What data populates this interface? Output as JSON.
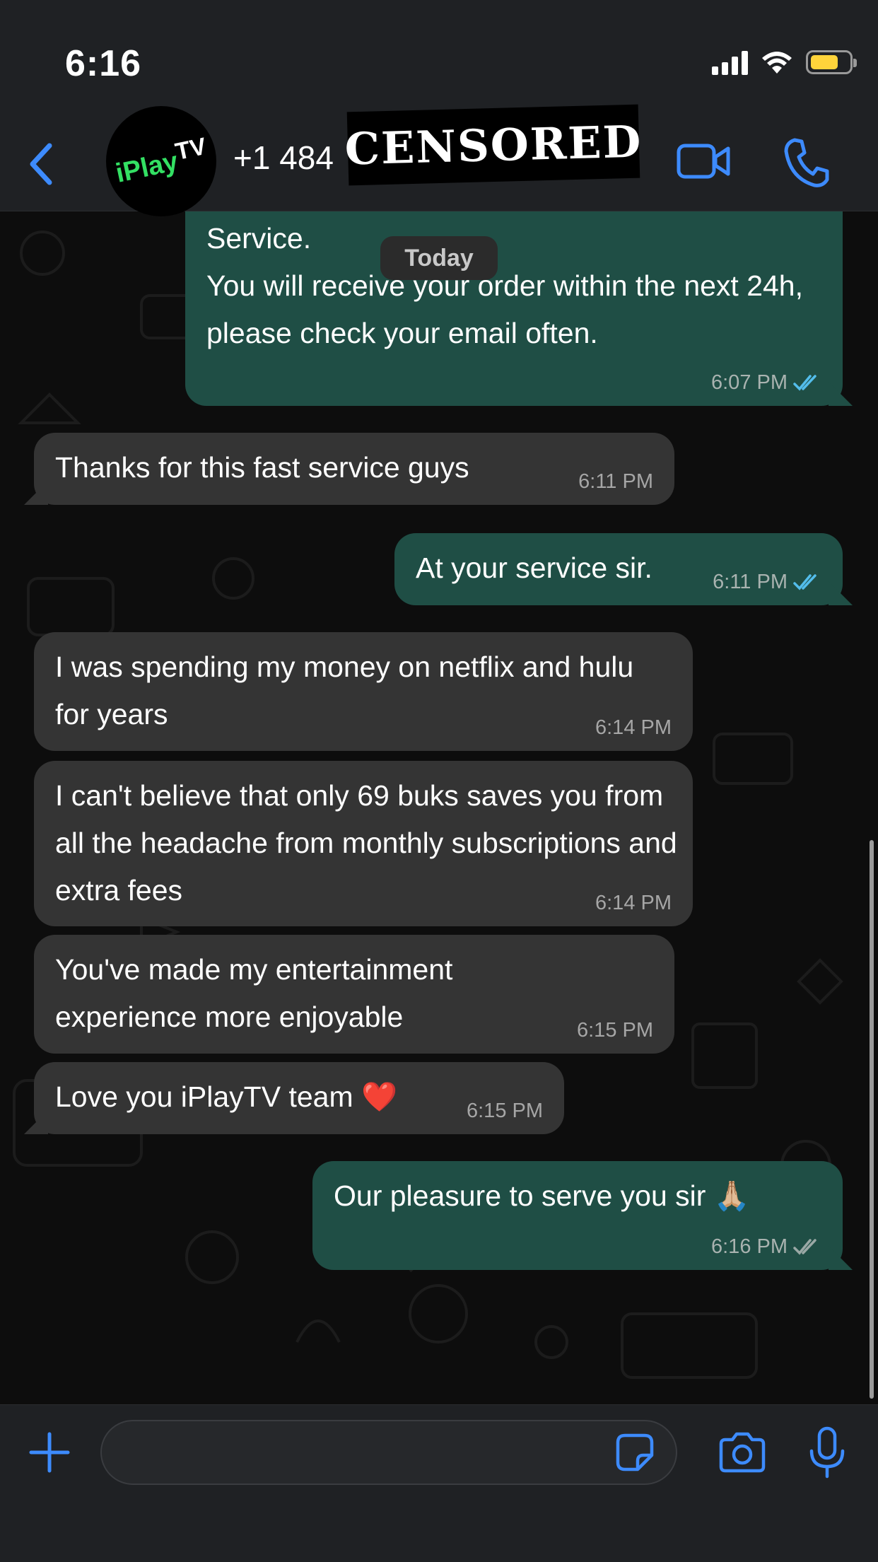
{
  "status_bar": {
    "time": "6:16"
  },
  "header": {
    "contact_name": "+1 484",
    "avatar": {
      "brand_main": "iPlay",
      "brand_super": "TV"
    },
    "censor_label": "CENSORED"
  },
  "chat": {
    "date_label": "Today",
    "messages": [
      {
        "dir": "out",
        "text": "Service.\nYou will receive your order within the next 24h, please check your email often.",
        "time": "6:07 PM",
        "read": true
      },
      {
        "dir": "in",
        "text": "Thanks for this fast service guys",
        "time": "6:11 PM"
      },
      {
        "dir": "out",
        "text": "At your service sir.",
        "time": "6:11 PM",
        "read": true
      },
      {
        "dir": "in",
        "text": "I was spending my money on netflix and hulu for years",
        "time": "6:14 PM"
      },
      {
        "dir": "in",
        "text": "I can't believe that only 69 buks saves you from all the headache from monthly subscriptions and extra fees",
        "time": "6:14 PM"
      },
      {
        "dir": "in",
        "text": "You've made my entertainment experience more enjoyable",
        "time": "6:15 PM"
      },
      {
        "dir": "in",
        "text": "Love you iPlayTV team",
        "emoji": "❤️",
        "time": "6:15 PM"
      },
      {
        "dir": "out",
        "text": "Our pleasure to serve you sir",
        "emoji": "🙏🏼",
        "time": "6:16 PM",
        "read": false
      }
    ]
  },
  "composer": {
    "value": "",
    "placeholder": ""
  },
  "colors": {
    "accent": "#3d8bfd",
    "outgoing_bubble": "#1f4e45",
    "incoming_bubble": "#343434",
    "read_tick": "#53bdeb",
    "battery": "#ffd43b",
    "brand_green": "#33e063"
  },
  "icons": [
    "back-chevron-icon",
    "video-call-icon",
    "phone-call-icon",
    "plus-icon",
    "sticker-icon",
    "camera-icon",
    "microphone-icon",
    "double-check-icon",
    "signal-icon",
    "wifi-icon",
    "battery-icon"
  ]
}
